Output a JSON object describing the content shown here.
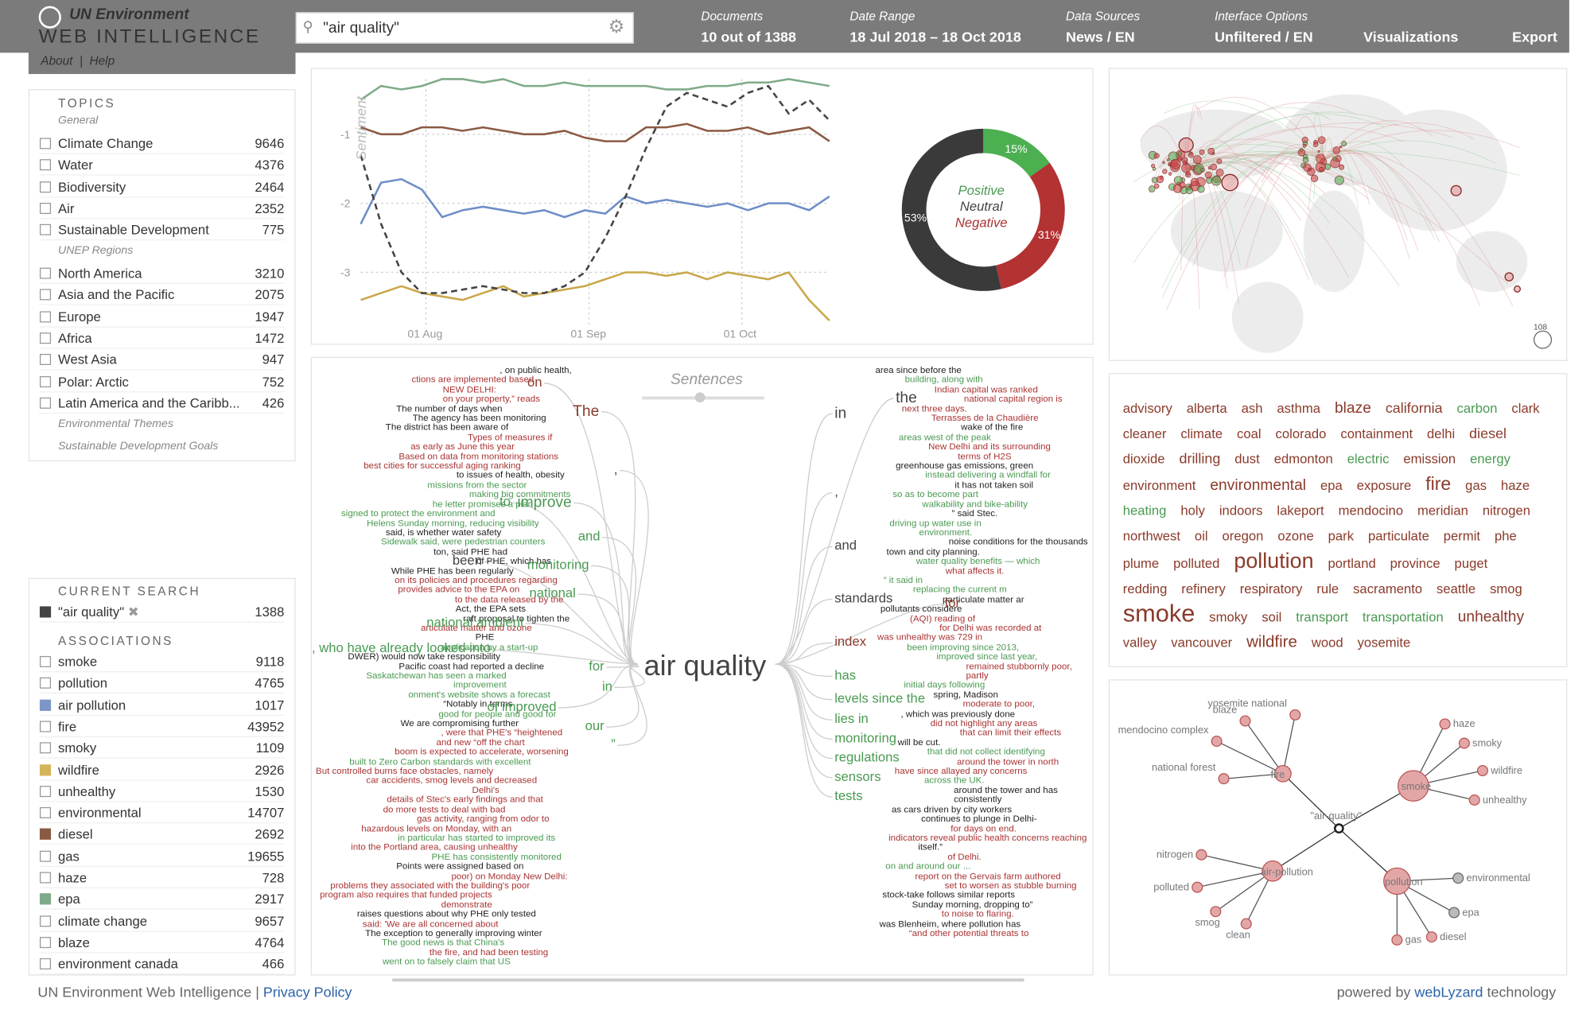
{
  "brand": {
    "line1": "UN Environment",
    "line2": "WEB INTELLIGENCE",
    "about": "About",
    "sep": "|",
    "help": "Help"
  },
  "search": {
    "query": "\"air quality\""
  },
  "header": {
    "documents": {
      "label": "Documents",
      "value": "10 out of 1388"
    },
    "date_range": {
      "label": "Date Range",
      "value": "18 Jul 2018 – 18 Oct 2018"
    },
    "data_sources": {
      "label": "Data Sources",
      "value": "News / EN"
    },
    "interface": {
      "label": "Interface Options",
      "value": "Unfiltered / EN"
    },
    "visualizations": "Visualizations",
    "export": "Export"
  },
  "topics": {
    "title": "TOPICS",
    "general": "General",
    "general_items": [
      {
        "label": "Climate Change",
        "count": "9646"
      },
      {
        "label": "Water",
        "count": "4376"
      },
      {
        "label": "Biodiversity",
        "count": "2464"
      },
      {
        "label": "Air",
        "count": "2352"
      },
      {
        "label": "Sustainable Development",
        "count": "775"
      }
    ],
    "regions_title": "UNEP Regions",
    "regions": [
      {
        "label": "North America",
        "count": "3210"
      },
      {
        "label": "Asia and the Pacific",
        "count": "2075"
      },
      {
        "label": "Europe",
        "count": "1947"
      },
      {
        "label": "Africa",
        "count": "1472"
      },
      {
        "label": "West Asia",
        "count": "947"
      },
      {
        "label": "Polar: Arctic",
        "count": "752"
      },
      {
        "label": "Latin America and the Caribb...",
        "count": "426"
      }
    ],
    "themes": "Environmental Themes",
    "sdg": "Sustainable Development Goals"
  },
  "current_search": {
    "title": "CURRENT SEARCH",
    "query": "\"air quality\"",
    "count": "1388",
    "color": "#444444"
  },
  "associations": {
    "title": "ASSOCIATIONS",
    "items": [
      {
        "label": "smoke",
        "count": "9118",
        "color": ""
      },
      {
        "label": "pollution",
        "count": "4765",
        "color": ""
      },
      {
        "label": "air pollution",
        "count": "1017",
        "color": "#7c96c8"
      },
      {
        "label": "fire",
        "count": "43952",
        "color": ""
      },
      {
        "label": "smoky",
        "count": "1109",
        "color": ""
      },
      {
        "label": "wildfire",
        "count": "2926",
        "color": "#d4b45a"
      },
      {
        "label": "unhealthy",
        "count": "1530",
        "color": ""
      },
      {
        "label": "environmental",
        "count": "14707",
        "color": ""
      },
      {
        "label": "diesel",
        "count": "2692",
        "color": "#8b5a44"
      },
      {
        "label": "gas",
        "count": "19655",
        "color": ""
      },
      {
        "label": "haze",
        "count": "728",
        "color": ""
      },
      {
        "label": "epa",
        "count": "2917",
        "color": "#7fab8a"
      },
      {
        "label": "climate change",
        "count": "9657",
        "color": ""
      },
      {
        "label": "blaze",
        "count": "4764",
        "color": ""
      },
      {
        "label": "environment canada",
        "count": "466",
        "color": ""
      }
    ]
  },
  "chart_data": [
    {
      "type": "line",
      "ylabel": "Sentiment",
      "yticks": [
        "-1",
        "-2",
        "-3"
      ],
      "xticks": [
        "01 Aug",
        "01 Sep",
        "01 Oct"
      ],
      "series": [
        {
          "color": "#7fab8a",
          "values": [
            -0.5,
            -0.3,
            -0.35,
            -0.3,
            -0.2,
            -0.2,
            -0.25,
            -0.2,
            -0.3,
            -0.3,
            -0.25,
            -0.3,
            -0.3,
            -0.3,
            -0.3,
            -0.35,
            -0.35,
            -0.3,
            -0.3,
            -0.25,
            -0.25,
            -0.2,
            -0.25,
            -0.3
          ]
        },
        {
          "color": "#8b5a44",
          "values": [
            -0.9,
            -1.0,
            -1.0,
            -0.9,
            -0.9,
            -0.95,
            -0.9,
            -0.95,
            -1.0,
            -1.0,
            -0.95,
            -1.05,
            -1.1,
            -1.1,
            -0.9,
            -0.9,
            -0.85,
            -0.95,
            -0.95,
            -0.9,
            -1.0,
            -0.95,
            -0.9,
            -1.1
          ]
        },
        {
          "color": "#6e8ec8",
          "values": [
            -2.3,
            -1.7,
            -1.65,
            -1.8,
            -2.2,
            -2.1,
            -2.05,
            -2.1,
            -2.15,
            -2.1,
            -2.2,
            -2.1,
            -2.15,
            -1.9,
            -2.0,
            -1.95,
            -2.0,
            -2.05,
            -2.0,
            -2.1,
            -2.0,
            -2.0,
            -2.1,
            -1.9
          ]
        },
        {
          "color": "#c9a84a",
          "values": [
            -3.4,
            -3.3,
            -3.2,
            -3.3,
            -3.35,
            -3.4,
            -3.3,
            -3.2,
            -3.35,
            -3.3,
            -3.25,
            -3.2,
            -3.1,
            -3.0,
            -3.0,
            -3.05,
            -3.0,
            -3.1,
            -3.0,
            -3.05,
            -3.1,
            -3.0,
            -3.4,
            -3.7
          ]
        },
        {
          "color": "#444444",
          "dash": true,
          "values": [
            -1.3,
            -2.3,
            -3.0,
            -3.3,
            -3.3,
            -3.25,
            -3.2,
            -3.25,
            -3.3,
            -3.3,
            -3.2,
            -3.0,
            -2.5,
            -1.9,
            -1.2,
            -0.6,
            -0.4,
            -0.5,
            -0.6,
            -0.4,
            -0.3,
            -0.7,
            -0.5,
            -0.8
          ]
        }
      ]
    },
    {
      "type": "pie",
      "labels": [
        "Positive",
        "Neutral",
        "Negative"
      ],
      "values": [
        15,
        53,
        31
      ],
      "colors": [
        "#4caf50",
        "#3a3a3a",
        "#b33232"
      ],
      "value_labels": [
        "15%",
        "53%",
        "31%"
      ]
    }
  ],
  "wordtree": {
    "center": "air quality",
    "slider_label": "Sentences",
    "left_words": [
      "on",
      "The",
      ",",
      "to",
      "improve",
      "and",
      "been",
      "monitoring",
      "national",
      "national ambient",
      ", who have already looked into",
      "for",
      "in",
      "of improved",
      "our",
      "”"
    ],
    "right_words": [
      "in",
      "the",
      ",",
      "and",
      "standards",
      "for",
      "index",
      "has",
      "levels since the",
      "lies in",
      "monitoring",
      "regulations",
      "sensors",
      "tests"
    ]
  },
  "wordtree_left_texts": [
    [
      ", on public health,",
      "k"
    ],
    [
      "ctions are implemented based",
      "r"
    ],
    [
      "NEW DELHI:",
      "r"
    ],
    [
      "on your property,” reads",
      "r"
    ],
    [
      "The number of days when",
      "k"
    ],
    [
      "The agency has been monitoring",
      "k"
    ],
    [
      "The district has been aware of",
      "k"
    ],
    [
      "Types of measures if",
      "r"
    ],
    [
      "as early as June this year",
      "r"
    ],
    [
      "Based on data from monitoring stations",
      "r"
    ],
    [
      "best cities for successful aging ranking",
      "r"
    ],
    [
      "to issues of health, obesity",
      "k"
    ],
    [
      "missions from the sector",
      "g"
    ],
    [
      "making big commitments",
      "g"
    ],
    [
      "he letter promises a plan",
      "g"
    ],
    [
      "signed to protect the environment and",
      "g"
    ],
    [
      "Helens Sunday morning, reducing visibility",
      "g"
    ],
    [
      "said, is whether water safety",
      "k"
    ],
    [
      "Sidewalk said, were pedestrian counters",
      "g"
    ],
    [
      "ton, said PHE had",
      "k"
    ],
    [
      "of PHE, which has",
      "k"
    ],
    [
      "While PHE has been regularly",
      "k"
    ],
    [
      "on its policies and procedures regarding",
      "r"
    ],
    [
      "provides advice to the EPA on",
      "r"
    ],
    [
      "to the data released by the",
      "r"
    ],
    [
      "Act, the EPA sets",
      "k"
    ],
    [
      "raft proposal to tighten the",
      "k"
    ],
    [
      "articulate matter and ozone",
      "r"
    ],
    [
      "PHE",
      "k"
    ],
    [
      "application by a start-up",
      "g"
    ],
    [
      "DWER) would now take responsibility",
      "k"
    ],
    [
      "Pacific coast had reported a decline",
      "k"
    ],
    [
      "Saskatchewan has seen a marked improvement",
      "g"
    ],
    [
      "onment's website shows a forecast",
      "g"
    ],
    [
      "“Notably in terms",
      "k"
    ],
    [
      "good for people and good for",
      "g"
    ],
    [
      "We are compromising further",
      "k"
    ],
    [
      ", were that PHE's “heightened",
      "r"
    ],
    [
      "and new “off the chart",
      "r"
    ],
    [
      "boom is expected to accelerate, worsening",
      "r"
    ],
    [
      "built to Zero Carbon standards with excellent",
      "g"
    ],
    [
      "But controlled burns face obstacles, namely",
      "r"
    ],
    [
      "car accidents, smog levels and decreased",
      "r"
    ],
    [
      "Delhi's",
      "r"
    ],
    [
      "details of Stec's early findings and that",
      "r"
    ],
    [
      "do more tests to deal with bad",
      "r"
    ],
    [
      "gas activity, ranging from odor to",
      "r"
    ],
    [
      "hazardous levels on Monday, with an",
      "r"
    ],
    [
      "in particular has started to improved its",
      "g"
    ],
    [
      "into the Portland area, causing unhealthy",
      "r"
    ],
    [
      "PHE has consistently monitored",
      "g"
    ],
    [
      "Points were assigned based on",
      "k"
    ],
    [
      "poor) on Monday New Delhi:",
      "r"
    ],
    [
      "problems they associated with the building's poor",
      "r"
    ],
    [
      "program also requires that funded projects demonstrate",
      "r"
    ],
    [
      "raises questions about why PHE only tested",
      "k"
    ],
    [
      "said: 'We are all concerned about",
      "r"
    ],
    [
      "The exception to generally improving winter",
      "k"
    ],
    [
      "The good news is that China's",
      "g"
    ],
    [
      "the fire, and had been testing",
      "r"
    ],
    [
      "went on to falsely claim that US",
      "g"
    ]
  ],
  "wordtree_right_texts": [
    [
      "area since before the",
      "k"
    ],
    [
      "building, along with",
      "g"
    ],
    [
      "Indian capital was ranked",
      "r"
    ],
    [
      "national capital region is",
      "r"
    ],
    [
      "next three days.",
      "r"
    ],
    [
      "Terrasses de la Chaudière",
      "r"
    ],
    [
      "wake of the fire",
      "k"
    ],
    [
      "areas west of the peak",
      "g"
    ],
    [
      "New Delhi and its surrounding",
      "r"
    ],
    [
      "terms of H2S",
      "r"
    ],
    [
      "greenhouse gas emissions, green",
      "k"
    ],
    [
      "instead delivering a windfall for",
      "g"
    ],
    [
      "it has not taken soil",
      "k"
    ],
    [
      "so as to become part",
      "g"
    ],
    [
      "walkability and bike-ability",
      "g"
    ],
    [
      "” said Stec.",
      "k"
    ],
    [
      "driving up water use in",
      "g"
    ],
    [
      "environment.",
      "g"
    ],
    [
      "noise conditions for the thousands",
      "k"
    ],
    [
      "town and city planning.",
      "k"
    ],
    [
      "water quality benefits — which",
      "g"
    ],
    [
      "what affects it.",
      "r"
    ],
    [
      "” it said in",
      "g"
    ],
    [
      "replacing the current m",
      "g"
    ],
    [
      "particulate matter ar",
      "k"
    ],
    [
      "pollutants considere",
      "k"
    ],
    [
      "(AQI) reading of",
      "r"
    ],
    [
      "for Delhi was recorded at",
      "r"
    ],
    [
      "was unhealthy was 729 in",
      "r"
    ],
    [
      "been improving since 2013,",
      "g"
    ],
    [
      "improved since last year,",
      "g"
    ],
    [
      "remained stubbornly poor, partly",
      "r"
    ],
    [
      "initial days following",
      "g"
    ],
    [
      "spring, Madison",
      "k"
    ],
    [
      "moderate to poor,",
      "r"
    ],
    [
      ", which was previously done",
      "k"
    ],
    [
      "did not highlight any areas",
      "r"
    ],
    [
      "that can limit their effects",
      "r"
    ],
    [
      "will be cut.",
      "k"
    ],
    [
      "that did not collect identifying",
      "g"
    ],
    [
      "around the tower in north",
      "r"
    ],
    [
      "have since allayed any concerns",
      "r"
    ],
    [
      "across the UK.",
      "g"
    ],
    [
      "around the tower and has consistently",
      "k"
    ],
    [
      "as cars driven by city workers",
      "k"
    ],
    [
      "continues to plunge in Delhi-",
      "k"
    ],
    [
      "for days on end.",
      "r"
    ],
    [
      "indicators reveal public health concerns reaching",
      "r"
    ],
    [
      "itself.”",
      "k"
    ],
    [
      "of Delhi.",
      "r"
    ],
    [
      "on and around our ...",
      "g"
    ],
    [
      "report on the Gervais farm authored",
      "r"
    ],
    [
      "set to worsen as stubble burning",
      "r"
    ],
    [
      "stock-take follows similar reports",
      "k"
    ],
    [
      "Sunday morning, dropping to”",
      "k"
    ],
    [
      "to noise to flaring.",
      "r"
    ],
    [
      "was Blenheim, where pollution has",
      "k"
    ],
    [
      "“and other potential threats to",
      "r"
    ]
  ],
  "map": {
    "zoom_label": "108"
  },
  "tagcloud": [
    [
      "advisory",
      "b"
    ],
    [
      "alberta",
      "b"
    ],
    [
      "ash",
      "b"
    ],
    [
      "asthma",
      "b"
    ],
    [
      "blaze",
      "b"
    ],
    [
      "california",
      "b"
    ],
    [
      "carbon",
      "g"
    ],
    [
      "clark",
      "b"
    ],
    [
      "cleaner",
      "b"
    ],
    [
      "climate",
      "b"
    ],
    [
      "coal",
      "b"
    ],
    [
      "colorado",
      "b"
    ],
    [
      "containment",
      "b"
    ],
    [
      "delhi",
      "b"
    ],
    [
      "diesel",
      "b"
    ],
    [
      "dioxide",
      "b"
    ],
    [
      "drilling",
      "b"
    ],
    [
      "dust",
      "b"
    ],
    [
      "edmonton",
      "b"
    ],
    [
      "electric",
      "g"
    ],
    [
      "emission",
      "b"
    ],
    [
      "energy",
      "g"
    ],
    [
      "environment",
      "b"
    ],
    [
      "environmental",
      "b"
    ],
    [
      "epa",
      "b"
    ],
    [
      "exposure",
      "b"
    ],
    [
      "fire",
      "b"
    ],
    [
      "gas",
      "b"
    ],
    [
      "haze",
      "b"
    ],
    [
      "heating",
      "g"
    ],
    [
      "holy",
      "b"
    ],
    [
      "indoors",
      "b"
    ],
    [
      "lakeport",
      "b"
    ],
    [
      "mendocino",
      "b"
    ],
    [
      "meridian",
      "b"
    ],
    [
      "nitrogen",
      "b"
    ],
    [
      "northwest",
      "b"
    ],
    [
      "oil",
      "b"
    ],
    [
      "oregon",
      "b"
    ],
    [
      "ozone",
      "b"
    ],
    [
      "park",
      "b"
    ],
    [
      "particulate",
      "b"
    ],
    [
      "permit",
      "b"
    ],
    [
      "phe",
      "b"
    ],
    [
      "plume",
      "b"
    ],
    [
      "polluted",
      "b"
    ],
    [
      "pollution",
      "b"
    ],
    [
      "portland",
      "b"
    ],
    [
      "province",
      "b"
    ],
    [
      "puget",
      "b"
    ],
    [
      "redding",
      "b"
    ],
    [
      "refinery",
      "b"
    ],
    [
      "respiratory",
      "b"
    ],
    [
      "rule",
      "b"
    ],
    [
      "sacramento",
      "b"
    ],
    [
      "seattle",
      "b"
    ],
    [
      "smog",
      "b"
    ],
    [
      "smoke",
      "b"
    ],
    [
      "smoky",
      "b"
    ],
    [
      "soil",
      "b"
    ],
    [
      "transport",
      "g"
    ],
    [
      "transportation",
      "g"
    ],
    [
      "unhealthy",
      "b"
    ],
    [
      "valley",
      "b"
    ],
    [
      "vancouver",
      "b"
    ],
    [
      "wildfire",
      "b"
    ],
    [
      "wood",
      "b"
    ],
    [
      "yosemite",
      "b"
    ]
  ],
  "network": {
    "center": "\"air-quality\"",
    "hubs": [
      "fire",
      "smoke",
      "air-pollution",
      "pollution"
    ],
    "fire_leaves": [
      "blaze",
      "yosemite national",
      "mendocino complex",
      "national forest"
    ],
    "smoke_leaves": [
      "haze",
      "smoky",
      "wildfire",
      "unhealthy"
    ],
    "airpollution_leaves": [
      "nitrogen",
      "polluted",
      "smog",
      "clean"
    ],
    "pollution_leaves": [
      "environmental",
      "epa",
      "diesel",
      "gas"
    ]
  },
  "footer": {
    "left": "UN Environment Web Intelligence",
    "sep": "|",
    "privacy": "Privacy Policy",
    "powered_pre": "powered by",
    "powered_link": "webLyzard",
    "powered_post": "technology"
  }
}
